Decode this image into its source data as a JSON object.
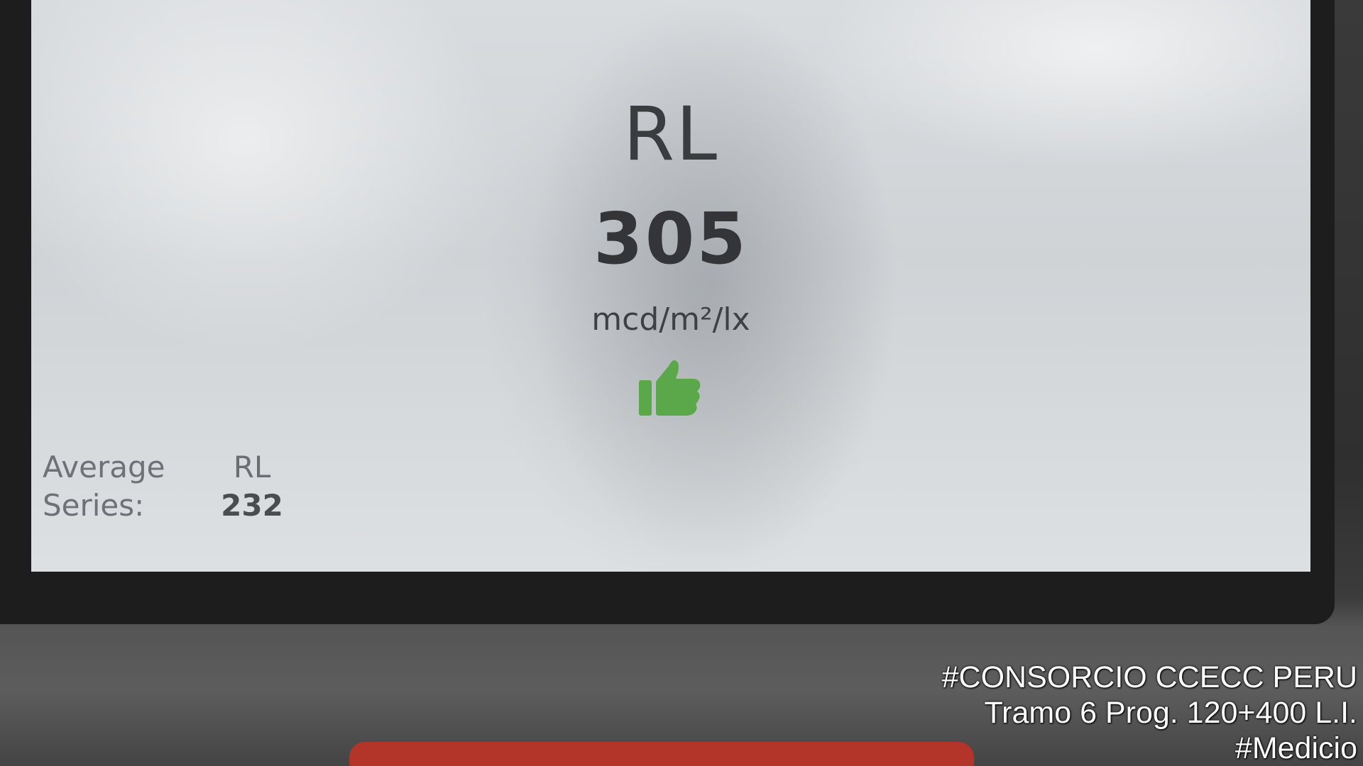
{
  "display": {
    "measure_label": "RL",
    "measure_value": "305",
    "unit": "mcd/m²/lx",
    "status_icon": "thumbs-up-icon",
    "status_color": "#5aa84a",
    "average_series": {
      "label_line1": "Average",
      "label_line2": "Series:",
      "column_header": "RL",
      "value": "232"
    }
  },
  "caption": {
    "line1": "#CONSORCIO CCECC PERU",
    "line2": "Tramo 6 Prog. 120+400 L.I.",
    "line3": "#Medicio"
  }
}
